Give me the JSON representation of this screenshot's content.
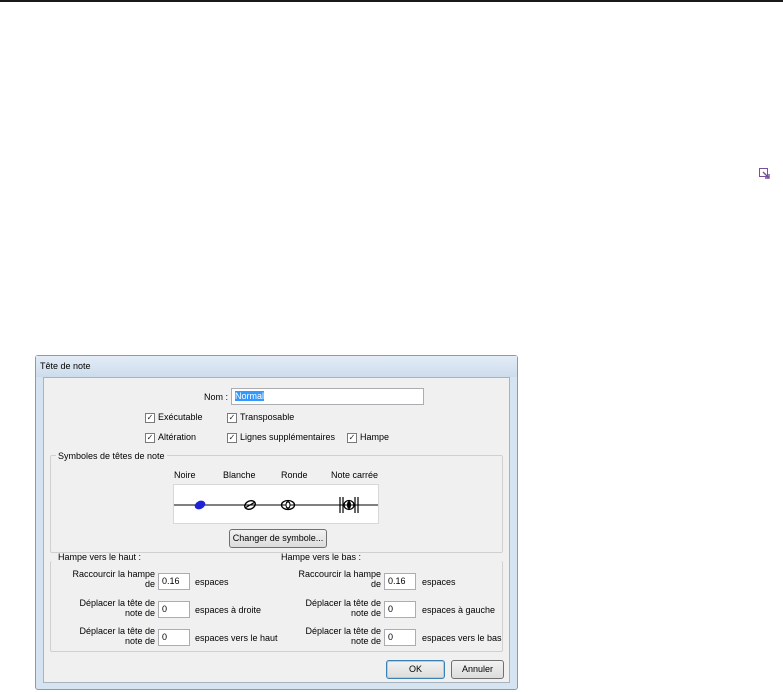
{
  "dialog": {
    "title": "Tête de note",
    "name_label": "Nom :",
    "name_value": "Normal",
    "checkboxes": {
      "executable": {
        "label": "Exécutable",
        "checked": true
      },
      "transposable": {
        "label": "Transposable",
        "checked": true
      },
      "alteration": {
        "label": "Altération",
        "checked": true
      },
      "ledger": {
        "label": "Lignes supplémentaires",
        "checked": true
      },
      "stem": {
        "label": "Hampe",
        "checked": true
      }
    },
    "symbols_group": {
      "label": "Symboles de têtes de note",
      "columns": [
        "Noire",
        "Blanche",
        "Ronde",
        "Note carrée"
      ],
      "change_button": "Changer de symbole..."
    },
    "stem_up": {
      "heading": "Hampe vers le haut :",
      "shorten_label_1": "Raccourcir la hampe",
      "shorten_label_2": "de",
      "shorten_value": "0.16",
      "shorten_unit": "espaces",
      "move_h_label_1": "Déplacer la tête de",
      "move_h_label_2": "note de",
      "move_h_value": "0",
      "move_h_unit": "espaces à droite",
      "move_v_label_1": "Déplacer la tête de",
      "move_v_label_2": "note de",
      "move_v_value": "0",
      "move_v_unit": "espaces vers le haut"
    },
    "stem_down": {
      "heading": "Hampe vers le bas :",
      "shorten_label_1": "Raccourcir la hampe",
      "shorten_label_2": "de",
      "shorten_value": "0.16",
      "shorten_unit": "espaces",
      "move_h_label_1": "Déplacer la tête de",
      "move_h_label_2": "note de",
      "move_h_value": "0",
      "move_h_unit": "espaces à gauche",
      "move_v_label_1": "Déplacer la tête de",
      "move_v_label_2": "note de",
      "move_v_value": "0",
      "move_v_unit": "espaces vers le bas"
    },
    "ok_button": "OK",
    "cancel_button": "Annuler"
  },
  "colors": {
    "quarter_note": "#1e22d8",
    "selection": "#3399ff",
    "dialog_frame": "#d6e3f1"
  },
  "icons": {
    "corner": "expand-arrow-icon",
    "check": "✓"
  }
}
